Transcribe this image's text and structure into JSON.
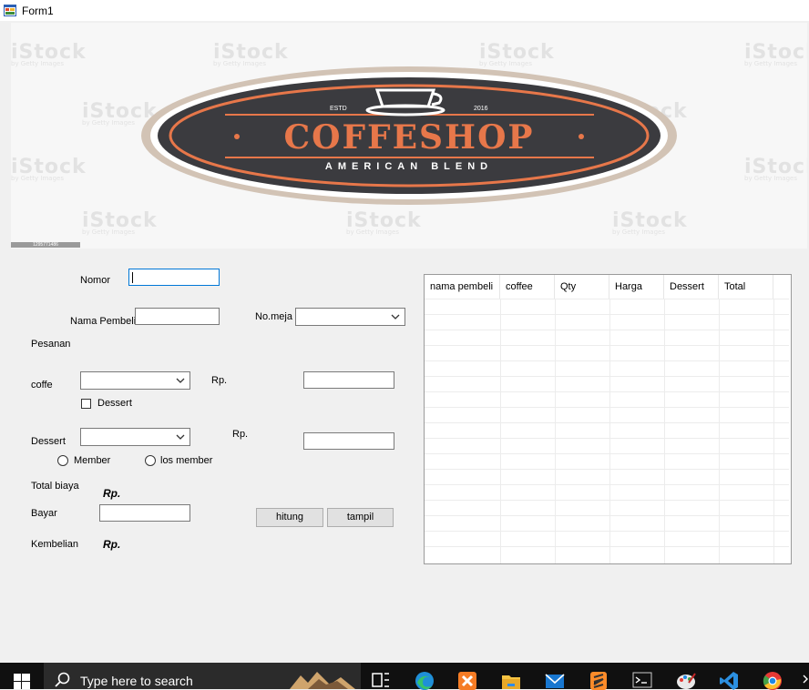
{
  "window": {
    "title": "Form1"
  },
  "banner": {
    "logo_main": "COFFESHOP",
    "logo_sub": "AMERICAN BLEND",
    "estd_left": "ESTD",
    "estd_right": "2016",
    "watermark": "iStock",
    "watermark_sub": "by Getty Images",
    "photo_id": "1295771486",
    "colors": {
      "orange": "#e7774a",
      "dark": "#3b3b3f",
      "beige": "#d2c3b5"
    }
  },
  "form": {
    "nomor_label": "Nomor",
    "nama_pembeli_label": "Nama Pembeli",
    "no_meja_label": "No.meja",
    "pesanan_label": "Pesanan",
    "coffe_label": "coffe",
    "rp_coffe_label": "Rp.",
    "dessert_checkbox_label": "Dessert",
    "dessert_label": "Dessert",
    "rp_dessert_label": "Rp.",
    "member_label": "Member",
    "los_member_label": "los member",
    "total_biaya_label": "Total biaya",
    "total_rp": "Rp.",
    "bayar_label": "Bayar",
    "kembelian_label": "Kembelian",
    "kembelian_rp": "Rp.",
    "hitung_button": "hitung",
    "tampil_button": "tampil"
  },
  "grid": {
    "columns": [
      "nama pembeli",
      "coffee",
      "Qty",
      "Harga",
      "Dessert",
      "Total"
    ]
  },
  "taskbar": {
    "search_placeholder": "Type here to search",
    "icons": [
      "windows-start-icon",
      "search-icon",
      "task-view-icon",
      "edge-icon",
      "xampp-icon",
      "file-explorer-icon",
      "mail-icon",
      "sublime-text-icon",
      "terminal-icon",
      "paint-icon",
      "vscode-icon",
      "chrome-icon"
    ]
  }
}
